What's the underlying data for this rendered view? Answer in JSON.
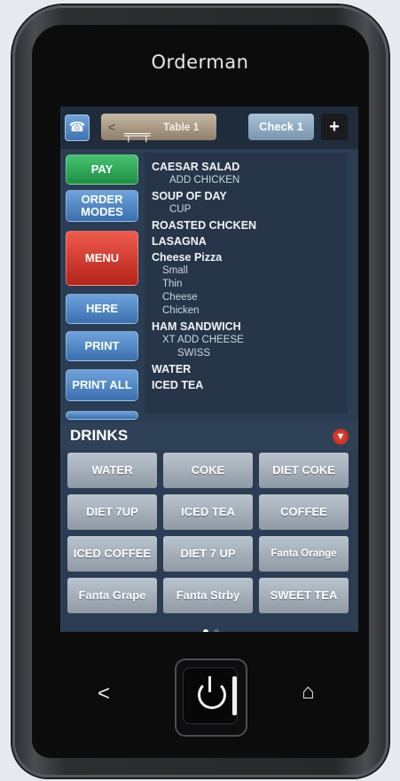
{
  "device": {
    "brand": "Orderman"
  },
  "topbar": {
    "back_chevron": "<",
    "table_label": "Table 1",
    "check_label": "Check 1",
    "add_label": "+"
  },
  "sidebar": [
    {
      "label": "PAY",
      "style": "green"
    },
    {
      "label": "ORDER MODES",
      "style": "blue"
    },
    {
      "label": "MENU",
      "style": "red"
    },
    {
      "label": "HERE",
      "style": "blue"
    },
    {
      "label": "PRINT",
      "style": "blue"
    },
    {
      "label": "PRINT ALL",
      "style": "blue"
    }
  ],
  "order_items": [
    {
      "name": "CAESAR SALAD",
      "mods": [
        "ADD CHICKEN"
      ]
    },
    {
      "name": "SOUP OF DAY",
      "mods": [
        "CUP"
      ]
    },
    {
      "name": "ROASTED CHCKEN",
      "mods": []
    },
    {
      "name": "LASAGNA",
      "mods": []
    },
    {
      "name": "Cheese Pizza",
      "mods": [
        "Small",
        "Thin",
        "Cheese",
        "Chicken"
      ]
    },
    {
      "name": "HAM SANDWICH",
      "mods": [
        "XT ADD CHEESE",
        "SWISS"
      ]
    },
    {
      "name": "WATER",
      "mods": []
    },
    {
      "name": "ICED TEA",
      "mods": []
    }
  ],
  "drinks": {
    "title": "DRINKS",
    "buttons": [
      "WATER",
      "COKE",
      "DIET COKE",
      "DIET 7UP",
      "ICED TEA",
      "COFFEE",
      "ICED COFFEE",
      "DIET 7 UP",
      "Fanta Orange",
      "Fanta Grape",
      "Fanta Strby",
      "SWEET TEA"
    ],
    "page_count": 2,
    "current_page": 1
  },
  "navkeys": {
    "back": "<",
    "home": "⌂"
  },
  "colors": {
    "screen_bg": "#2b3d52",
    "pay_green": "#2fa858",
    "menu_red": "#d8392c",
    "button_blue": "#4f87c6",
    "drink_gray": "#a3aeb9"
  }
}
